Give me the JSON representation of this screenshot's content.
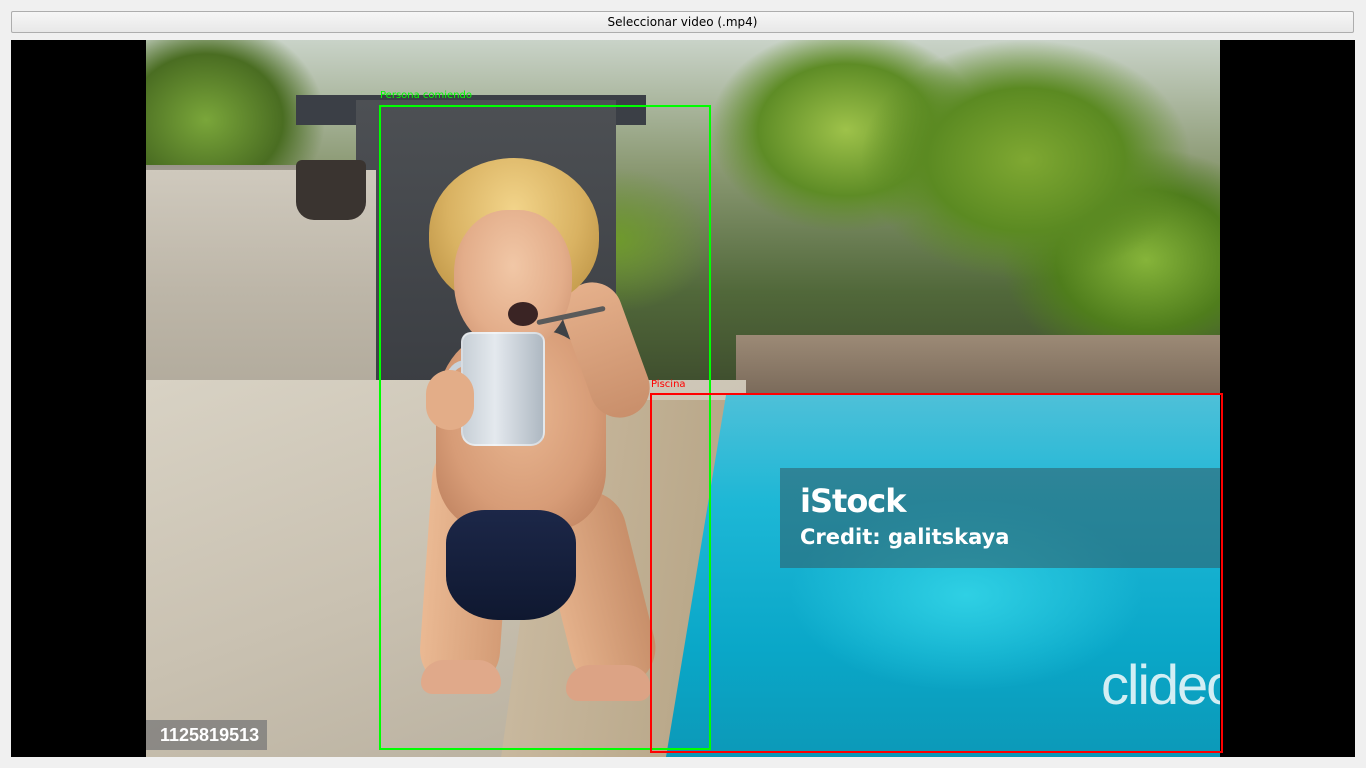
{
  "toolbar": {
    "select_video_label": "Seleccionar video (.mp4)"
  },
  "video": {
    "watermark_stock": "iStock",
    "watermark_credit": "Credit: galitskaya",
    "image_id": "1125819513",
    "watermark_clideo": "clideo.com"
  },
  "detections": [
    {
      "label": "Persona comiendo",
      "color": "#00ff00"
    },
    {
      "label": "Piscina",
      "color": "#ff0000"
    }
  ]
}
